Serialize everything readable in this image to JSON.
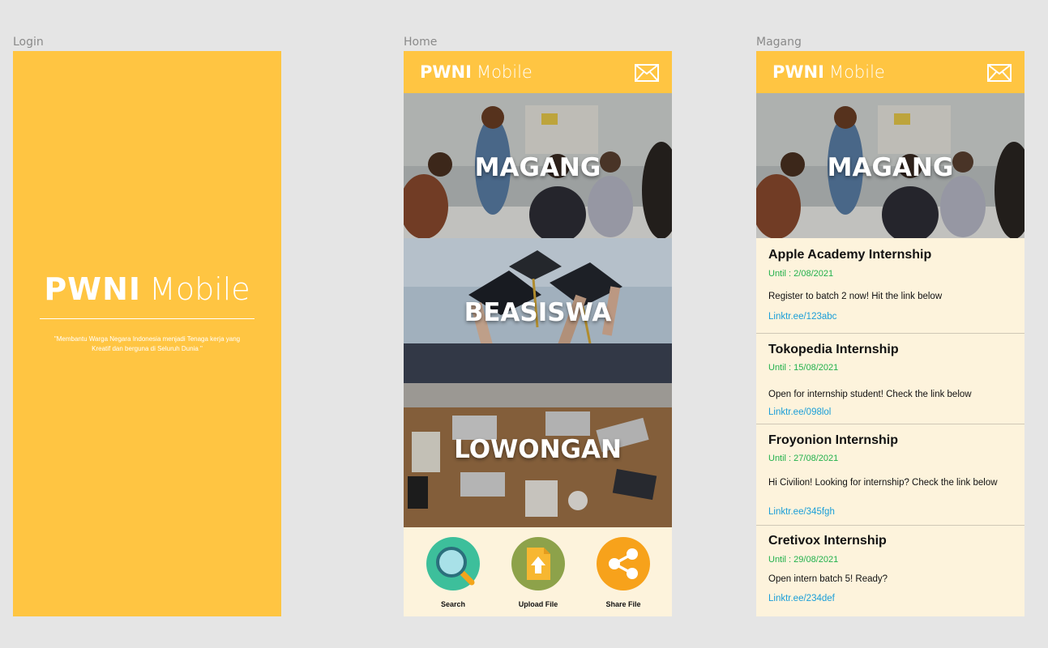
{
  "frames": {
    "login_label": "Login",
    "home_label": "Home",
    "magang_label": "Magang"
  },
  "brand": {
    "bold": "PWNI",
    "light": "Mobile"
  },
  "login": {
    "tagline": "\"Membantu Warga Negara Indonesia menjadi Tenaga kerja yang Kreatif dan berguna di Seluruh Dunia \""
  },
  "home": {
    "categories": [
      {
        "label": "MAGANG"
      },
      {
        "label": "BEASISWA"
      },
      {
        "label": "LOWONGAN"
      }
    ],
    "actions": [
      {
        "label": "Search",
        "icon": "search-icon",
        "color": "#3dbf9b"
      },
      {
        "label": "Upload File",
        "icon": "upload-file-icon",
        "color": "#8da24a"
      },
      {
        "label": "Share File",
        "icon": "share-icon",
        "color": "#f7a21b"
      }
    ]
  },
  "magang": {
    "hero": "MAGANG",
    "items": [
      {
        "title": "Apple Academy Internship",
        "until": "Until : 2/08/2021",
        "desc": "Register to batch 2 now! Hit the link below",
        "link": "Linktr.ee/123abc"
      },
      {
        "title": "Tokopedia Internship",
        "until": "Until : 15/08/2021",
        "desc": "Open for internship student! Check the link below",
        "link": "Linktr.ee/098lol"
      },
      {
        "title": "Froyonion Internship",
        "until": "Until : 27/08/2021",
        "desc": "Hi Civilion! Looking for internship? Check the link below",
        "link": "Linktr.ee/345fgh"
      },
      {
        "title": "Cretivox Internship",
        "until": "Until : 29/08/2021",
        "desc": "Open intern batch 5! Ready?",
        "link": "Linktr.ee/234def"
      }
    ]
  },
  "colors": {
    "primary": "#ffc542",
    "cream": "#fdf3dc",
    "until_green": "#22b14c",
    "link_blue": "#1a9ed8"
  }
}
